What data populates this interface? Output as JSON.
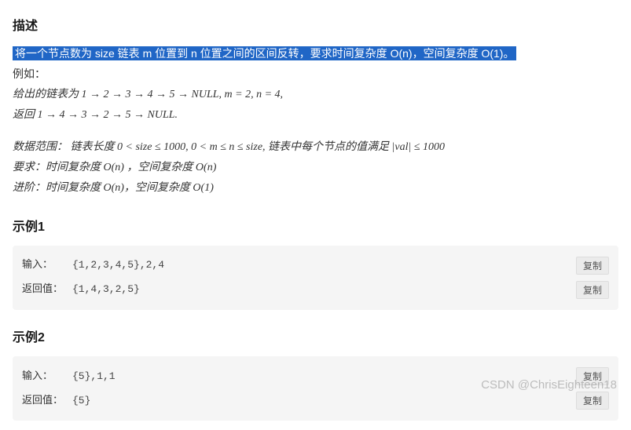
{
  "sections": {
    "desc_heading": "描述",
    "highlighted": "将一个节点数为 size 链表 m 位置到 n 位置之间的区间反转，要求时间复杂度 O(n)，空间复杂度 O(1)。",
    "example_intro": "例如：",
    "example_given": "给出的链表为 1 → 2 → 3 → 4 → 5 → NULL, m = 2, n = 4,",
    "example_return": "返回 1 → 4 → 3 → 2 → 5 → NULL.",
    "range_line": "数据范围：  链表长度 0 < size ≤ 1000,  0 < m ≤ n ≤ size,  链表中每个节点的值满足 |val| ≤ 1000",
    "require_line": "要求：时间复杂度 O(n) ，空间复杂度 O(n)",
    "advance_line": "进阶：时间复杂度 O(n)，空间复杂度 O(1)"
  },
  "examples": [
    {
      "heading": "示例1",
      "input_label": "输入：",
      "input_value": "{1,2,3,4,5},2,4",
      "return_label": "返回值：",
      "return_value": "{1,4,3,2,5}"
    },
    {
      "heading": "示例2",
      "input_label": "输入：",
      "input_value": "{5},1,1",
      "return_label": "返回值：",
      "return_value": "{5}"
    }
  ],
  "buttons": {
    "copy": "复制"
  },
  "watermark": "CSDN @ChrisEighteen18"
}
